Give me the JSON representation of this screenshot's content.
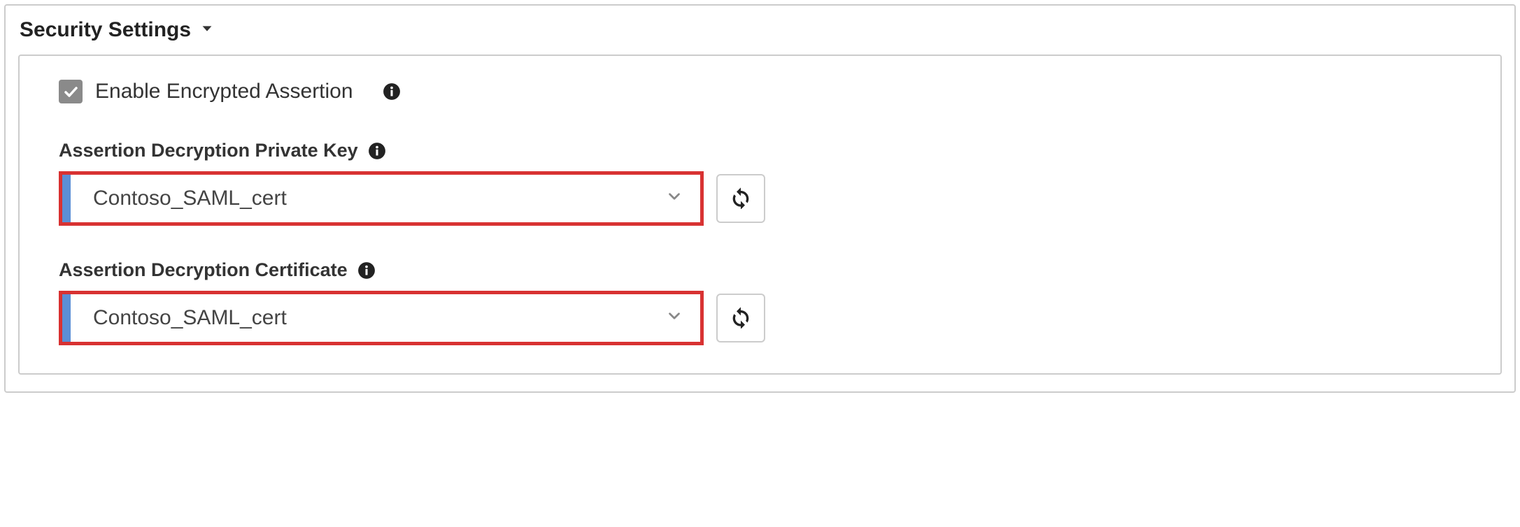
{
  "section": {
    "title": "Security Settings"
  },
  "enableEncrypted": {
    "label": "Enable Encrypted Assertion",
    "checked": true
  },
  "privateKey": {
    "label": "Assertion Decryption Private Key",
    "value": "Contoso_SAML_cert"
  },
  "certificate": {
    "label": "Assertion Decryption Certificate",
    "value": "Contoso_SAML_cert"
  },
  "colors": {
    "highlight": "#d83232",
    "accent": "#5b8fd6"
  }
}
